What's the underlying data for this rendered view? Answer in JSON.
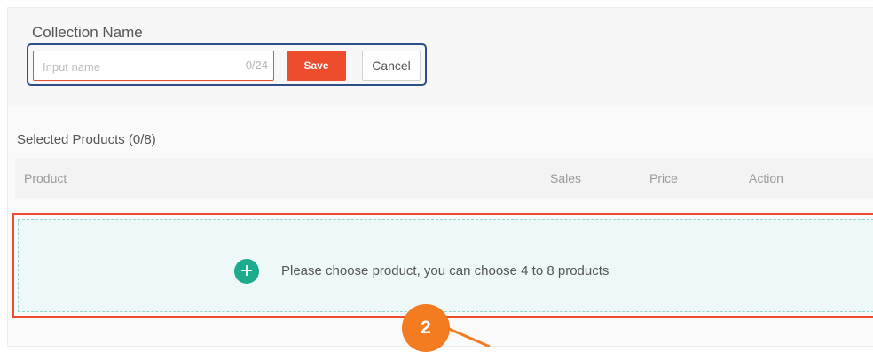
{
  "collection": {
    "label": "Collection Name",
    "input_placeholder": "Input name",
    "input_value": "",
    "counter": "0/24",
    "save_label": "Save",
    "cancel_label": "Cancel"
  },
  "selected": {
    "title": "Selected Products (0/8)",
    "columns": [
      "Product",
      "Sales",
      "Price",
      "Action"
    ]
  },
  "add_area": {
    "message": "Please choose product, you can choose 4 to 8 products",
    "icon": "plus-circle-icon"
  },
  "annotation": {
    "step_number": "2"
  },
  "colors": {
    "accent": "#ee4d2d",
    "focus_border": "#2b4f86",
    "add_icon": "#1dab8d",
    "badge": "#f47b20"
  }
}
